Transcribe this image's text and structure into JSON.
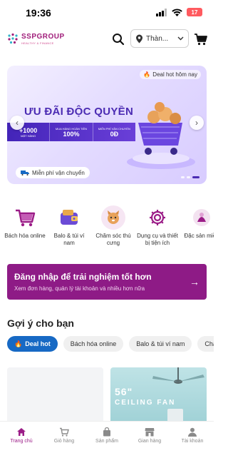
{
  "status_bar": {
    "time": "19:36",
    "battery": "17"
  },
  "header": {
    "logo_name": "SSPGROUP",
    "logo_tagline": "HEALTHY & FINANCE",
    "location_value": "Thàn..."
  },
  "banner": {
    "deal_label": "Deal hot hôm nay",
    "title": "ƯU ĐÃI ĐỘC QUYỀN",
    "promo": [
      {
        "big": "+1000",
        "small": "MẶT HÀNG"
      },
      {
        "small": "MUA HÀNG HOÀN TIỀN",
        "big": "100%"
      },
      {
        "small": "MIỄN PHÍ VẬN CHUYỂN",
        "big": "0Đ"
      }
    ],
    "shipping_label": "Miễn phí vận chuyển"
  },
  "categories": [
    {
      "label": "Bách hóa online",
      "icon": "basket-icon",
      "color": "#9b1c87"
    },
    {
      "label": "Balo & túi ví nam",
      "icon": "wallet-icon",
      "color": "#6b4bd6"
    },
    {
      "label": "Chăm sóc thú cưng",
      "icon": "pet-icon",
      "color": "#e08b3a"
    },
    {
      "label": "Dụng cụ và thiết bị tiện ích",
      "icon": "gear-icon",
      "color": "#9b1c87"
    },
    {
      "label": "Đặc sản miền",
      "icon": "specialty-icon",
      "color": "#9b1c87"
    }
  ],
  "login_card": {
    "title": "Đăng nhập để trải nghiệm tốt hơn",
    "subtitle": "Xem đơn hàng, quản lý tài khoản và nhiều hơn nữa"
  },
  "suggestions": {
    "title": "Gợi ý cho bạn",
    "chips": [
      "Deal hot",
      "Bách hóa online",
      "Balo & túi ví nam",
      "Chă"
    ]
  },
  "products": {
    "fan_size": "56\"",
    "fan_text": "CEILING FAN"
  },
  "bottom_nav": [
    {
      "label": "Trang chủ",
      "icon": "home-icon",
      "active": true
    },
    {
      "label": "Giỏ hàng",
      "icon": "cart-icon",
      "active": false
    },
    {
      "label": "Sản phẩm",
      "icon": "bag-icon",
      "active": false
    },
    {
      "label": "Gian hàng",
      "icon": "store-icon",
      "active": false
    },
    {
      "label": "Tài khoản",
      "icon": "user-icon",
      "active": false
    }
  ],
  "colors": {
    "brand": "#9b1c87",
    "accent": "#1769c4",
    "banner_purple": "#4b2bb3"
  }
}
